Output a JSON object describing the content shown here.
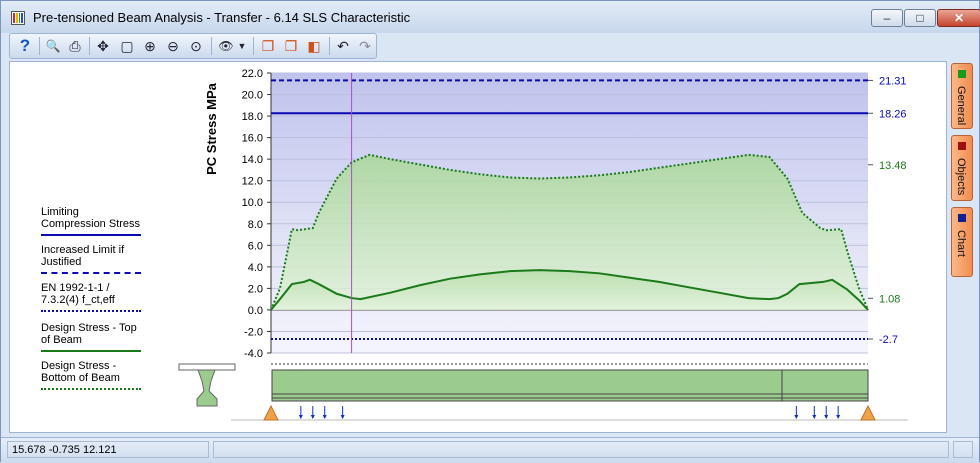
{
  "window": {
    "title": "Pre-tensioned Beam Analysis - Transfer - 6.14 SLS Characteristic",
    "controls": {
      "minimize": "–",
      "maximize": "□",
      "close": "✕"
    }
  },
  "toolbar": {
    "buttons": [
      {
        "name": "help-icon",
        "glyph": "?"
      },
      {
        "name": "print-preview-icon",
        "glyph": "🔍"
      },
      {
        "name": "print-icon",
        "glyph": "⎙"
      },
      {
        "name": "pan-icon",
        "glyph": "✥"
      },
      {
        "name": "zoom-window-icon",
        "glyph": "▢"
      },
      {
        "name": "zoom-in-icon",
        "glyph": "⊕"
      },
      {
        "name": "zoom-out-icon",
        "glyph": "⊖"
      },
      {
        "name": "zoom-extents-icon",
        "glyph": "⊙"
      },
      {
        "name": "view-options-icon",
        "glyph": "👁"
      },
      {
        "name": "copy-icon",
        "glyph": "❐"
      },
      {
        "name": "copy-alt-icon",
        "glyph": "❐"
      },
      {
        "name": "3d-view-icon",
        "glyph": "◧"
      },
      {
        "name": "undo-view-icon",
        "glyph": "↶"
      },
      {
        "name": "redo-view-icon",
        "glyph": "↷"
      }
    ]
  },
  "side_tabs": [
    {
      "label": "General",
      "color": "#1a9a1a"
    },
    {
      "label": "Objects",
      "color": "#a01010"
    },
    {
      "label": "Chart",
      "color": "#102090"
    }
  ],
  "legend": [
    {
      "label": "Limiting Compression Stress",
      "color": "#0a0ab4",
      "style": "solid"
    },
    {
      "label": "Increased Limit if Justified",
      "color": "#0a0ab4",
      "style": "dashed"
    },
    {
      "label": "EN 1992-1-1 / 7.3.2(4) f_ct,eff",
      "color": "#0a0ab4",
      "style": "dotted"
    },
    {
      "label": "Design Stress - Top of Beam",
      "color": "#1a7a1a",
      "style": "solid"
    },
    {
      "label": "Design Stress - Bottom of Beam",
      "color": "#1a7a1a",
      "style": "dotted"
    }
  ],
  "status": {
    "coords": "15.678  -0.735  12.121",
    "cell2": "",
    "cell3": ""
  },
  "chart_data": {
    "type": "area",
    "ylabel": "PC Stress  MPa",
    "ylim": [
      -4,
      22
    ],
    "yticks": [
      -4.0,
      -2.0,
      0.0,
      2.0,
      4.0,
      6.0,
      8.0,
      10.0,
      12.0,
      14.0,
      16.0,
      18.0,
      20.0,
      22.0
    ],
    "xlim": [
      0,
      1
    ],
    "grid": true,
    "limits": [
      {
        "name": "Increased Limit if Justified",
        "value": 21.31,
        "label": "21.31",
        "color": "#0a0ab4",
        "style": "dashed"
      },
      {
        "name": "Limiting Compression Stress",
        "value": 18.26,
        "label": "18.26",
        "color": "#0a0ab4",
        "style": "solid"
      },
      {
        "name": "EN 1992-1-1 / 7.3.2(4) f_ct,eff",
        "value": -2.7,
        "label": "-2.7",
        "color": "#0a0ab4",
        "style": "dotted"
      }
    ],
    "right_labels": [
      {
        "value": 13.48,
        "label": "13.48",
        "color": "#1a7a1a"
      },
      {
        "value": 1.08,
        "label": "1.08",
        "color": "#1a7a1a"
      }
    ],
    "cursor_x": 0.135,
    "series": [
      {
        "name": "Design Stress - Bottom of Beam",
        "style": "dotted",
        "color": "#1a7a1a",
        "x": [
          0,
          0.015,
          0.035,
          0.045,
          0.07,
          0.08,
          0.11,
          0.135,
          0.165,
          0.2,
          0.25,
          0.3,
          0.35,
          0.4,
          0.45,
          0.5,
          0.55,
          0.6,
          0.65,
          0.7,
          0.75,
          0.8,
          0.835,
          0.865,
          0.89,
          0.92,
          0.93,
          0.955,
          0.965,
          0.985,
          1
        ],
        "y": [
          0,
          2.0,
          7.5,
          7.4,
          7.6,
          9.0,
          12.2,
          13.7,
          14.4,
          14.0,
          13.5,
          13.0,
          12.6,
          12.3,
          12.2,
          12.3,
          12.5,
          12.8,
          13.2,
          13.6,
          14.0,
          14.4,
          14.2,
          12.2,
          9.0,
          7.6,
          7.4,
          7.5,
          5.5,
          2.0,
          0
        ]
      },
      {
        "name": "Design Stress - Top of Beam",
        "style": "solid",
        "color": "#1a7a1a",
        "x": [
          0,
          0.015,
          0.035,
          0.055,
          0.065,
          0.08,
          0.11,
          0.135,
          0.15,
          0.2,
          0.25,
          0.3,
          0.35,
          0.4,
          0.45,
          0.5,
          0.55,
          0.6,
          0.65,
          0.7,
          0.75,
          0.8,
          0.835,
          0.85,
          0.865,
          0.885,
          0.925,
          0.94,
          0.965,
          0.985,
          1
        ],
        "y": [
          0,
          1.0,
          2.4,
          2.6,
          2.8,
          2.4,
          1.5,
          1.1,
          1.0,
          1.6,
          2.3,
          2.9,
          3.3,
          3.6,
          3.7,
          3.6,
          3.4,
          3.0,
          2.6,
          2.1,
          1.6,
          1.1,
          1.0,
          1.1,
          1.5,
          2.4,
          2.6,
          2.8,
          1.9,
          0.9,
          0
        ]
      }
    ]
  }
}
